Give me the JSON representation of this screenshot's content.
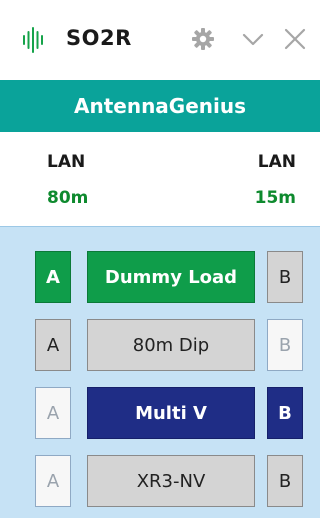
{
  "window": {
    "title": "SO2R",
    "logo_icon": "antenna-signal-icon",
    "settings_icon": "gear-icon",
    "collapse_icon": "chevron-down-icon",
    "close_icon": "close-icon"
  },
  "header": {
    "title": "AntennaGenius",
    "bg_color": "#0aa39a"
  },
  "info": {
    "left": {
      "label": "LAN",
      "band": "80m"
    },
    "right": {
      "label": "LAN",
      "band": "15m"
    }
  },
  "antennas": [
    {
      "name": "Dummy Load",
      "port_a": "A",
      "port_b": "B",
      "state": "active-a"
    },
    {
      "name": "80m Dip",
      "port_a": "A",
      "port_b": "B",
      "state": "a-available"
    },
    {
      "name": "Multi V",
      "port_a": "A",
      "port_b": "B",
      "state": "active-b"
    },
    {
      "name": "XR3-NV",
      "port_a": "A",
      "port_b": "B",
      "state": "b-available"
    }
  ],
  "colors": {
    "active_a": "#0f9d4a",
    "active_b": "#1f2d86",
    "panel_bg": "#c6e2f5",
    "band_text": "#0e8a2e"
  }
}
